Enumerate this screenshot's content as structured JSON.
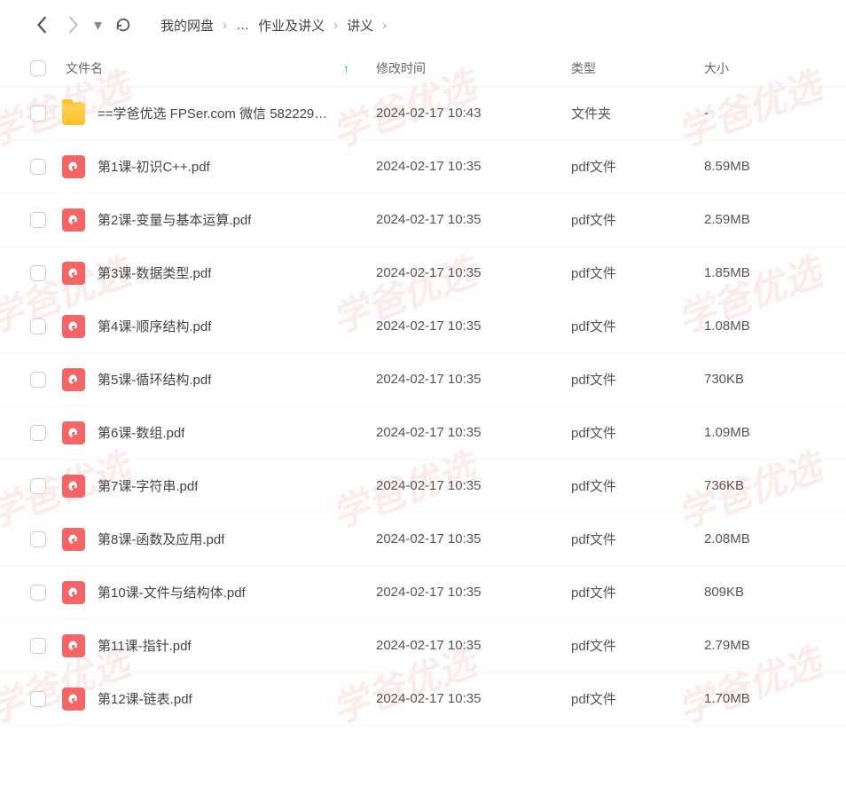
{
  "watermark_text": "学爸优选",
  "breadcrumb": {
    "root": "我的网盘",
    "ellipsis": "…",
    "mid": "作业及讲义",
    "current": "讲义"
  },
  "columns": {
    "name": "文件名",
    "mtime": "修改时间",
    "type": "类型",
    "size": "大小"
  },
  "files": [
    {
      "icon": "folder",
      "name": "==学爸优选 FPSer.com 微信 582229…",
      "mtime": "2024-02-17 10:43",
      "type": "文件夹",
      "size": "-"
    },
    {
      "icon": "pdf",
      "name": "第1课-初识C++.pdf",
      "mtime": "2024-02-17 10:35",
      "type": "pdf文件",
      "size": "8.59MB"
    },
    {
      "icon": "pdf",
      "name": "第2课-变量与基本运算.pdf",
      "mtime": "2024-02-17 10:35",
      "type": "pdf文件",
      "size": "2.59MB"
    },
    {
      "icon": "pdf",
      "name": "第3课-数据类型.pdf",
      "mtime": "2024-02-17 10:35",
      "type": "pdf文件",
      "size": "1.85MB"
    },
    {
      "icon": "pdf",
      "name": "第4课-顺序结构.pdf",
      "mtime": "2024-02-17 10:35",
      "type": "pdf文件",
      "size": "1.08MB"
    },
    {
      "icon": "pdf",
      "name": "第5课-循环结构.pdf",
      "mtime": "2024-02-17 10:35",
      "type": "pdf文件",
      "size": "730KB"
    },
    {
      "icon": "pdf",
      "name": "第6课-数组.pdf",
      "mtime": "2024-02-17 10:35",
      "type": "pdf文件",
      "size": "1.09MB"
    },
    {
      "icon": "pdf",
      "name": "第7课-字符串.pdf",
      "mtime": "2024-02-17 10:35",
      "type": "pdf文件",
      "size": "736KB"
    },
    {
      "icon": "pdf",
      "name": "第8课-函数及应用.pdf",
      "mtime": "2024-02-17 10:35",
      "type": "pdf文件",
      "size": "2.08MB"
    },
    {
      "icon": "pdf",
      "name": "第10课-文件与结构体.pdf",
      "mtime": "2024-02-17 10:35",
      "type": "pdf文件",
      "size": "809KB"
    },
    {
      "icon": "pdf",
      "name": "第11课-指针.pdf",
      "mtime": "2024-02-17 10:35",
      "type": "pdf文件",
      "size": "2.79MB"
    },
    {
      "icon": "pdf",
      "name": "第12课-链表.pdf",
      "mtime": "2024-02-17 10:35",
      "type": "pdf文件",
      "size": "1.70MB"
    }
  ]
}
